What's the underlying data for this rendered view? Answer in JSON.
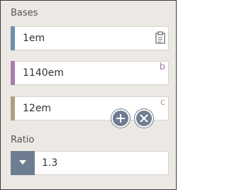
{
  "bases": {
    "label": "Bases",
    "fields": [
      {
        "value": "1em",
        "letter": "",
        "color": "#6f8fae"
      },
      {
        "value": "1140em",
        "letter": "b",
        "color": "#a97eb0"
      },
      {
        "value": "12em",
        "letter": "c",
        "color": "#b39e84"
      }
    ]
  },
  "ratio": {
    "label": "Ratio",
    "value": "1.3"
  },
  "icons": {
    "copy": "clipboard-icon",
    "add": "plus-icon",
    "remove": "close-icon",
    "dropdown": "caret-down-icon"
  },
  "colors": {
    "button": "#6f7d92",
    "panel_bg": "#ece8e3"
  }
}
